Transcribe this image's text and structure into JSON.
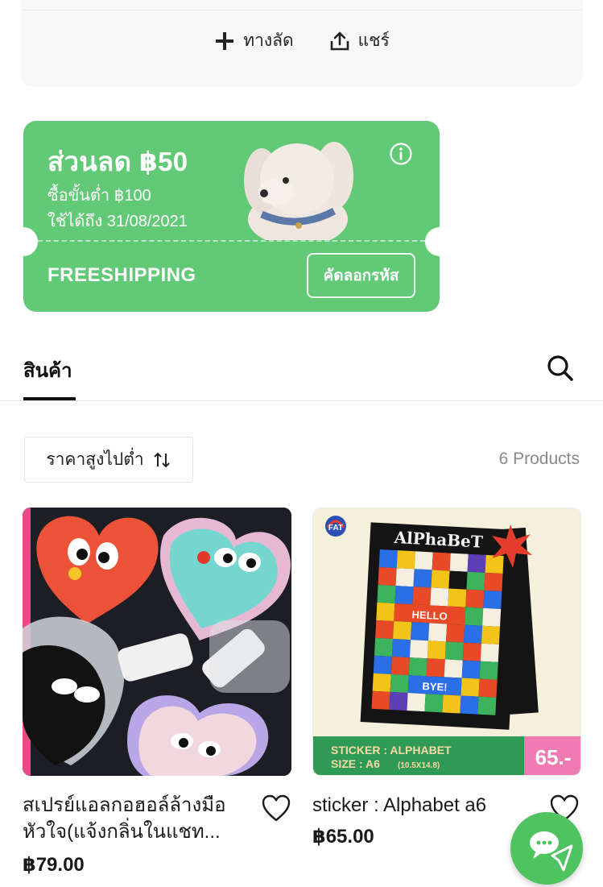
{
  "top_actions": {
    "shortcut_label": "ทางลัด",
    "share_label": "แชร์"
  },
  "coupon": {
    "title": "ส่วนลด ฿50",
    "min_spend": "ซื้อขั้นต่ำ ฿100",
    "valid_until": "ใช้ได้ถึง 31/08/2021",
    "code": "FREESHIPPING",
    "copy_label": "คัดลอกรหัส",
    "color": "#62c977"
  },
  "tabs": {
    "products_label": "สินค้า"
  },
  "sort": {
    "label": "ราคาสูงไปต่ำ"
  },
  "product_count": "6 Products",
  "products": [
    {
      "name_line1": "สเปรย์แอลกอฮอล์ล้างมือ",
      "name_line2": "หัวใจ(แจ้งกลิ่นในแชท...",
      "price": "฿79.00",
      "icon": "heart-icon"
    },
    {
      "name_line1": "sticker : Alphabet a6",
      "price": "฿65.00",
      "icon": "heart-icon",
      "image_text": {
        "brand": "FAT",
        "poster_title": "AlPhaBeT",
        "banner_line1": "STICKER : ALPHABET",
        "banner_line2": "SIZE : A6",
        "banner_size": "(10.5X14.8)",
        "price_tag": "65.-",
        "hello": "HELLO",
        "bye": "BYE!"
      }
    }
  ],
  "chat": {
    "icon": "chat-icon",
    "color": "#4fc35f"
  }
}
